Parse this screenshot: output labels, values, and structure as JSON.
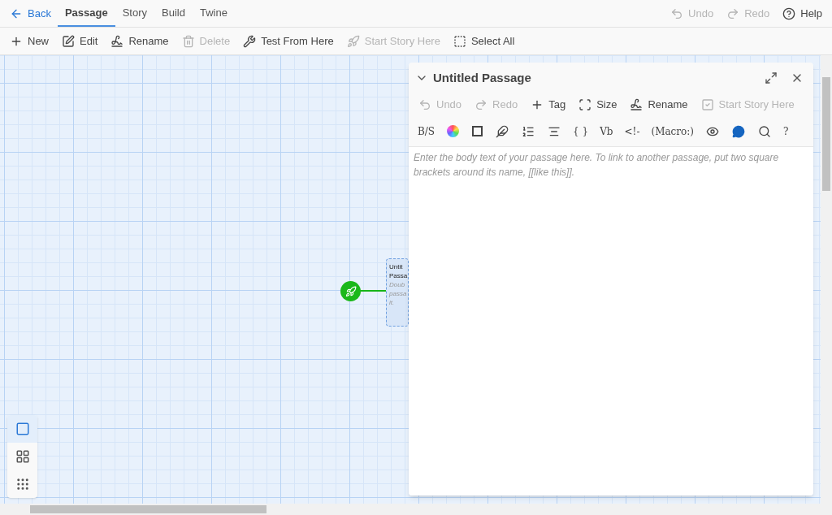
{
  "top_bar": {
    "back": "Back",
    "tabs": [
      {
        "label": "Passage",
        "selected": true
      },
      {
        "label": "Story",
        "selected": false
      },
      {
        "label": "Build",
        "selected": false
      },
      {
        "label": "Twine",
        "selected": false
      }
    ],
    "actions": [
      {
        "label": "Undo",
        "disabled": true
      },
      {
        "label": "Redo",
        "disabled": true
      },
      {
        "label": "Help",
        "disabled": false
      }
    ]
  },
  "toolbar": [
    {
      "label": "New",
      "disabled": false
    },
    {
      "label": "Edit",
      "disabled": false
    },
    {
      "label": "Rename",
      "disabled": false
    },
    {
      "label": "Delete",
      "disabled": true
    },
    {
      "label": "Test From Here",
      "disabled": false
    },
    {
      "label": "Start Story Here",
      "disabled": true
    },
    {
      "label": "Select All",
      "disabled": false
    }
  ],
  "passage_card": {
    "title": "Untit Passa",
    "excerpt": "Doub passa it."
  },
  "zoom_buttons": [
    {
      "selected": true
    },
    {
      "selected": false
    },
    {
      "selected": false
    }
  ],
  "dialog": {
    "title": "Untitled Passage",
    "actions": [
      {
        "label": "Undo",
        "disabled": true
      },
      {
        "label": "Redo",
        "disabled": true
      },
      {
        "label": "Tag",
        "disabled": false
      },
      {
        "label": "Size",
        "disabled": false
      },
      {
        "label": "Rename",
        "disabled": false
      },
      {
        "label": "Start Story Here",
        "disabled": true
      }
    ],
    "format_tools": [
      {
        "kind": "text",
        "text": "B/S"
      },
      {
        "kind": "icon"
      },
      {
        "kind": "icon"
      },
      {
        "kind": "icon"
      },
      {
        "kind": "icon"
      },
      {
        "kind": "icon"
      },
      {
        "kind": "text",
        "text": "{ }"
      },
      {
        "kind": "text",
        "text": "Vb"
      },
      {
        "kind": "text",
        "text": "<!-"
      },
      {
        "kind": "text",
        "text": "(Macro:)"
      },
      {
        "kind": "icon"
      },
      {
        "kind": "icon"
      },
      {
        "kind": "icon"
      },
      {
        "kind": "text",
        "text": "?"
      }
    ],
    "body": {
      "placeholder": "Enter the body text of your passage here. To link to another passage, put two square brackets around its name, [[like this]]."
    }
  }
}
